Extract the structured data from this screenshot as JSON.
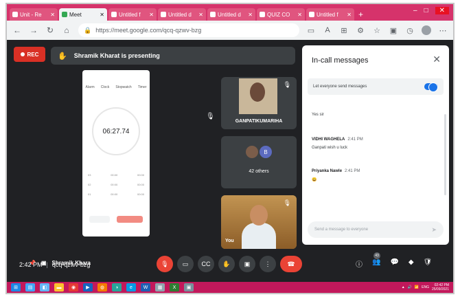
{
  "browser": {
    "tabs": [
      {
        "title": "Unit - Re",
        "active": false
      },
      {
        "title": "Meet",
        "active": true
      },
      {
        "title": "Untitled f",
        "active": false
      },
      {
        "title": "Untitled d",
        "active": false
      },
      {
        "title": "Untitled d",
        "active": false
      },
      {
        "title": "QUIZ CO",
        "active": false
      },
      {
        "title": "Untitled f",
        "active": false
      }
    ],
    "new_tab": "+",
    "url": "https://meet.google.com/qcq-qzwv-bzg",
    "window_controls": {
      "minimize": "–",
      "maximize": "□",
      "close": "✕"
    }
  },
  "meet": {
    "rec_label": "REC",
    "presenting_banner": "Shramik Kharat is presenting",
    "presenter_name": "Shramik Khara",
    "stopwatch": {
      "tabs": [
        "Alarm",
        "Clock",
        "Stopwatch",
        "Timer"
      ],
      "time": "06:27.74",
      "laps": [
        {
          "n": "03",
          "a": "00:00",
          "b": "00:00"
        },
        {
          "n": "02",
          "a": "00:00",
          "b": "00:00"
        },
        {
          "n": "01",
          "a": "00:00",
          "b": "00:00"
        }
      ]
    },
    "tiles": [
      {
        "name": "GANPATIKUMARIHA"
      },
      {
        "initial_a": "",
        "initial_b": "B",
        "count_label": "42 others"
      },
      {
        "name": "You"
      }
    ],
    "meeting_time": "2:42 PM",
    "separator": "|",
    "meeting_code": "qcq-qzwv-bzg"
  },
  "chat": {
    "title": "In-call messages",
    "close_icon": "✕",
    "setting_label": "Let everyone send messages",
    "setting_on": true,
    "messages": [
      {
        "sender": "",
        "time": "",
        "text": "Yes sir"
      },
      {
        "sender": "VIDHI WAGHELA",
        "time": "2:41 PM",
        "text": "Ganpati  wish  u luck"
      },
      {
        "sender": "Priyanka Nawle",
        "time": "2:41 PM",
        "text": "😀"
      }
    ],
    "input_placeholder": "Send a message to everyone"
  },
  "controls": {
    "participants_count": "43"
  },
  "taskbar": {
    "lang": "ENG",
    "clock_time": "02:42 PM",
    "clock_date": "25/09/2021"
  },
  "colors": {
    "meet_bg": "#202124",
    "tile_bg": "#3c4043",
    "danger_red": "#ea4335",
    "accent_blue": "#1a73e8",
    "tab_strip": "#d6336b"
  }
}
